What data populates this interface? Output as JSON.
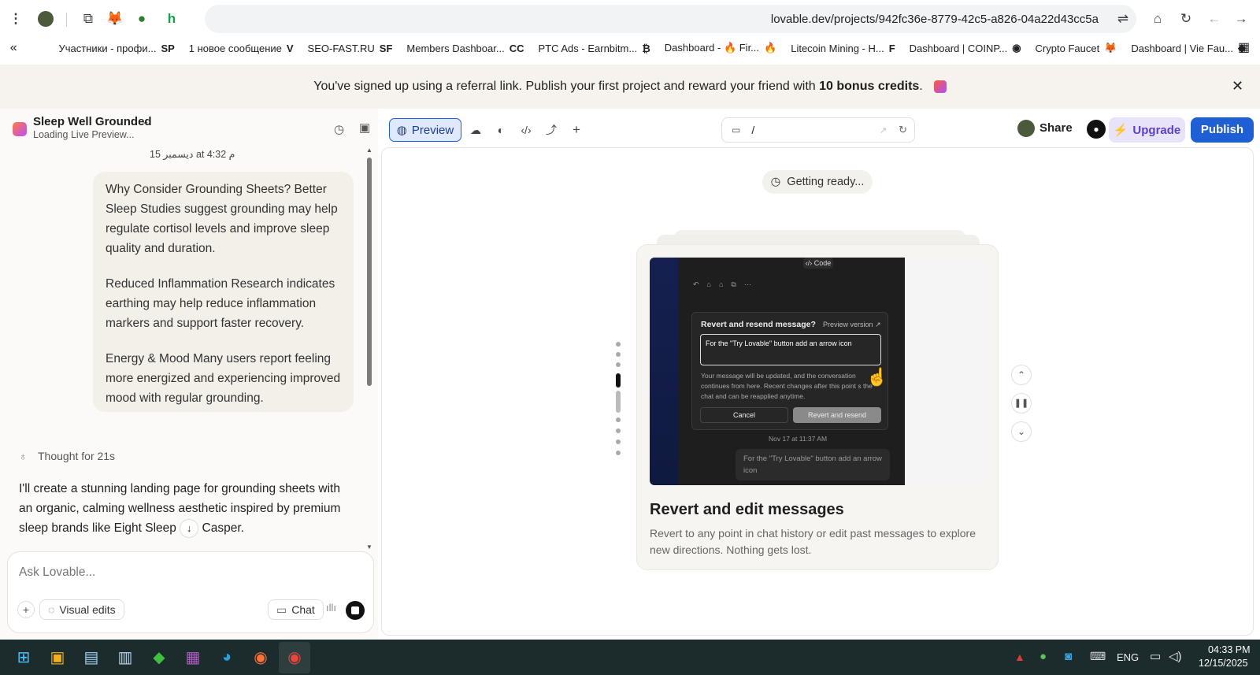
{
  "browser": {
    "url": "lovable.dev/projects/942fc36e-8779-42c5-a826-04a22d43cc5a",
    "bookmarks": [
      {
        "icon": "SP",
        "label": "Участники - профи..."
      },
      {
        "icon": "V",
        "label": "1 новое сообщение"
      },
      {
        "icon": "SF",
        "label": "SEO-FAST.RU"
      },
      {
        "icon": "CC",
        "label": "Members Dashboar..."
      },
      {
        "icon": "₿",
        "label": "PTC Ads - Earnbitm..."
      },
      {
        "icon": "🔥",
        "label": "Dashboard - 🔥 Fir..."
      },
      {
        "icon": "F",
        "label": "Litecoin Mining - H..."
      },
      {
        "icon": "◉",
        "label": "Dashboard | COINP..."
      },
      {
        "icon": "🦊",
        "label": "Crypto Faucet"
      },
      {
        "icon": "◆",
        "label": "Dashboard | Vie Fau..."
      }
    ]
  },
  "banner": {
    "text_before": "You've signed up using a referral link. Publish your first project and reward your friend with ",
    "bold": "10 bonus credits",
    "text_after": "."
  },
  "project": {
    "name": "Sleep Well Grounded",
    "status": "Loading Live Preview..."
  },
  "chat": {
    "timestamp": "15 ديسمبر at 4:32 م",
    "user_paragraphs": [
      "Why Consider Grounding Sheets? Better Sleep Studies suggest grounding may help regulate cortisol levels and improve sleep quality and duration.",
      "Reduced Inflammation Research indicates earthing may help reduce inflammation markers and support faster recovery.",
      "Energy & Mood Many users report feeling more energized and experiencing improved mood with regular grounding."
    ],
    "thought": "Thought for 21s",
    "assistant_text": "I'll create a stunning landing page for grounding sheets with an organic, calming wellness aesthetic inspired by premium sleep brands like Eight Sleep",
    "assistant_text_tail": "Casper."
  },
  "composer": {
    "placeholder": "Ask Lovable...",
    "visual_edits": "Visual edits",
    "chat": "Chat"
  },
  "toolbar": {
    "preview": "Preview",
    "route": "/",
    "share": "Share",
    "upgrade": "Upgrade",
    "publish": "Publish"
  },
  "preview": {
    "status": "Getting ready...",
    "card_title": "Revert and edit messages",
    "card_desc": "Revert to any point in chat history or edit past messages to explore new directions. Nothing gets lost.",
    "shot": {
      "code_tab": "Code",
      "dialog_title": "Revert and resend message?",
      "preview_version": "Preview version ↗",
      "input_text": "For the \"Try Lovable\" button add an arrow icon",
      "dialog_note": "Your message will be updated, and the conversation continues from here. Recent changes after this point s the chat and can be reapplied anytime.",
      "cancel": "Cancel",
      "revert": "Revert and resend",
      "date": "Nov 17 at 11:37 AM",
      "bubble": "For the \"Try Lovable\" button add an arrow icon"
    }
  },
  "taskbar": {
    "lang": "ENG",
    "time": "04:33 PM",
    "date": "12/15/2025"
  },
  "colors": {
    "accent": "#1f5fd6",
    "upgrade_bg": "#e8e2fb",
    "banner_bg": "#f6f3ee"
  }
}
